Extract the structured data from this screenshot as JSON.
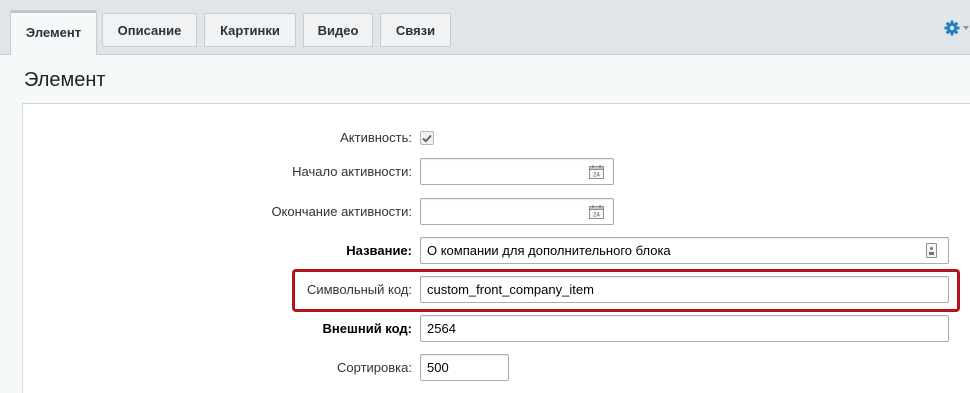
{
  "tabs": [
    {
      "label": "Элемент",
      "active": true
    },
    {
      "label": "Описание",
      "active": false
    },
    {
      "label": "Картинки",
      "active": false
    },
    {
      "label": "Видео",
      "active": false
    },
    {
      "label": "Связи",
      "active": false
    }
  ],
  "panel": {
    "title": "Элемент"
  },
  "form": {
    "active": {
      "label": "Активность:",
      "checked": true
    },
    "active_from": {
      "label": "Начало активности:",
      "value": "",
      "calendar_day": "24"
    },
    "active_to": {
      "label": "Окончание активности:",
      "value": "",
      "calendar_day": "24"
    },
    "name": {
      "label": "Название:",
      "value": "О компании для дополнительного блока"
    },
    "code": {
      "label": "Символьный код:",
      "value": "custom_front_company_item"
    },
    "xml_id": {
      "label": "Внешний код:",
      "value": "2564"
    },
    "sort": {
      "label": "Сортировка:",
      "value": "500"
    }
  },
  "colors": {
    "highlight": "#b0151b",
    "gear": "#1d7fc4"
  },
  "icons": {
    "settings": "gear-icon",
    "calendar": "calendar-icon",
    "translit": "document-icon"
  }
}
